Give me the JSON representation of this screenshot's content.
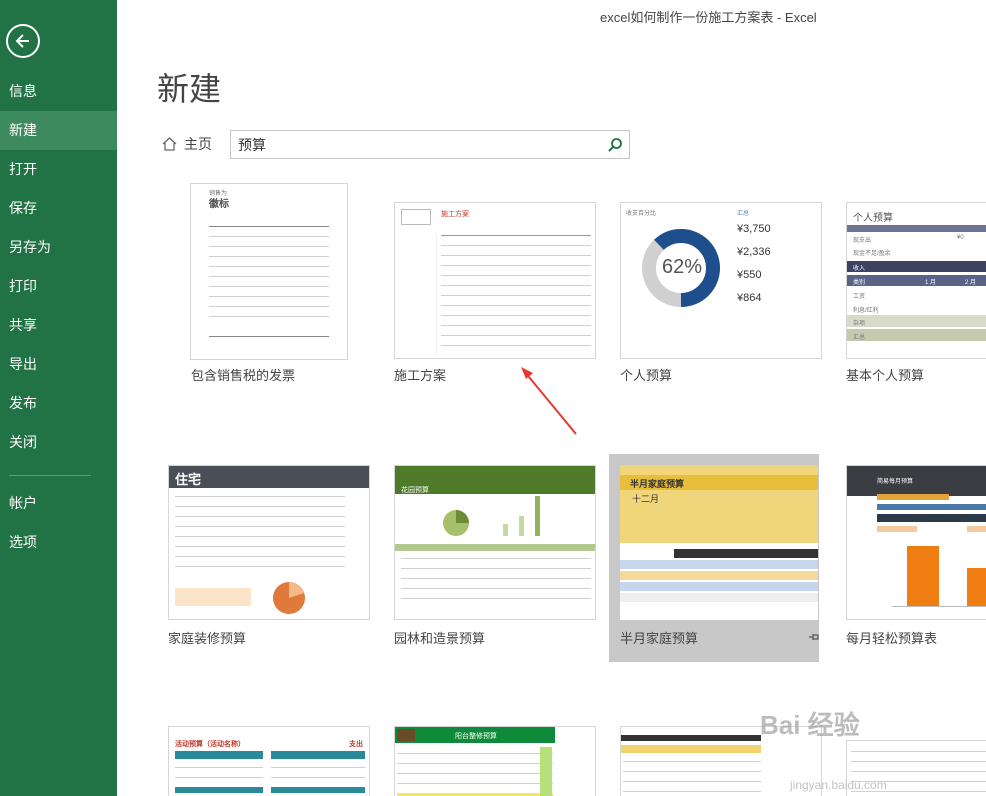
{
  "window": {
    "title": "excel如何制作一份施工方案表 - Excel"
  },
  "sidebar": {
    "back_icon": "back-arrow-icon",
    "items": [
      {
        "label": "信息"
      },
      {
        "label": "新建"
      },
      {
        "label": "打开"
      },
      {
        "label": "保存"
      },
      {
        "label": "另存为"
      },
      {
        "label": "打印"
      },
      {
        "label": "共享"
      },
      {
        "label": "导出"
      },
      {
        "label": "发布"
      },
      {
        "label": "关闭"
      },
      {
        "label": "帐户"
      },
      {
        "label": "选项"
      }
    ],
    "active": "新建",
    "bg_color": "#217346"
  },
  "page": {
    "title": "新建"
  },
  "nav": {
    "home_label": "主页",
    "home_icon": "home-icon"
  },
  "search": {
    "value": "预算",
    "icon": "search-icon"
  },
  "templates": [
    {
      "label": "包含销售税的发票",
      "thumb": {
        "title": "销售为",
        "subtitle": "徽标"
      }
    },
    {
      "label": "施工方案",
      "thumb": {
        "title": "施工方案"
      }
    },
    {
      "label": "个人预算",
      "thumb": {
        "percent": "62%",
        "header": "收支百分比",
        "summary": "汇总",
        "values": [
          "¥3,750",
          "¥2,336",
          "¥550",
          "¥864"
        ]
      }
    },
    {
      "label": "基本个人预算",
      "thumb": {
        "title": "个人预算",
        "rows": [
          "现支出",
          "现金不足/盈余",
          "收入",
          "类别",
          "工资",
          "利息/红利",
          "杂项",
          "汇总"
        ],
        "months": [
          "1 月",
          "2 月"
        ],
        "zero": "¥0"
      }
    },
    {
      "label": "家庭装修预算",
      "thumb": {
        "title": "住宅"
      }
    },
    {
      "label": "园林和造景预算",
      "thumb": {
        "title": "花园预算"
      }
    },
    {
      "label": "半月家庭预算",
      "thumb": {
        "title": "半月家庭预算",
        "month": "十二月"
      }
    },
    {
      "label": "每月轻松预算表",
      "thumb": {
        "title": "简易每月预算"
      }
    },
    {
      "label": "",
      "thumb": {
        "title": "活动预算（活动名称）",
        "right": "支出"
      }
    },
    {
      "label": "",
      "thumb": {
        "title": "阳台整修预算"
      }
    },
    {
      "label": "",
      "thumb": {}
    },
    {
      "label": "",
      "thumb": {}
    }
  ],
  "selected_template": "半月家庭预算",
  "pin_icon": "pin-icon",
  "annotation": {
    "icon": "red-arrow-icon",
    "color": "#e53935"
  },
  "watermark": {
    "text": "Bai 经验",
    "sub": "jingyan.baidu.com"
  }
}
